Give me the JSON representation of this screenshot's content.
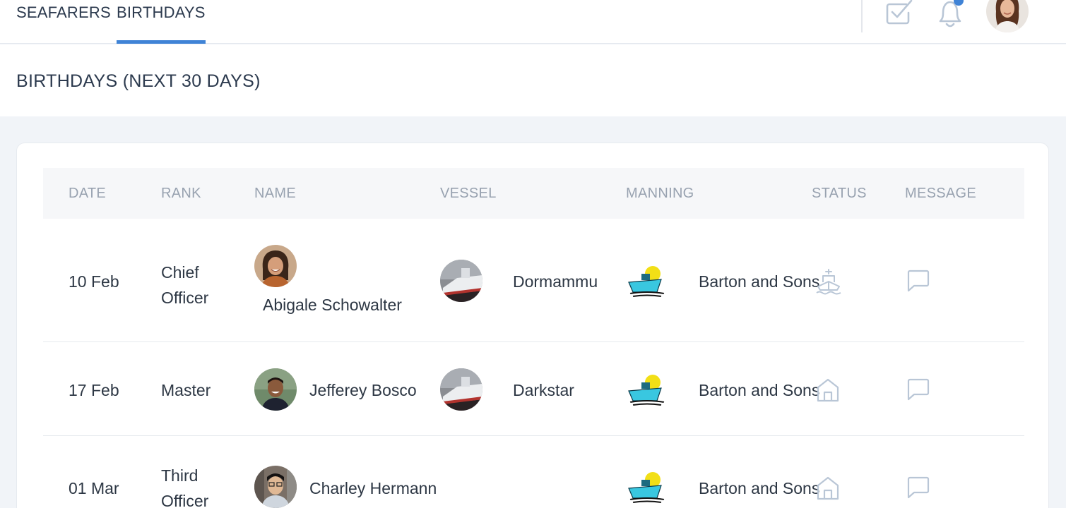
{
  "nav": {
    "tabs": [
      {
        "label": "SEAFARERS",
        "active": false
      },
      {
        "label": "BIRTHDAYS",
        "active": true
      }
    ],
    "icons": [
      "task-check-icon",
      "bell-icon"
    ],
    "notification_dot_color": "#3f83d6"
  },
  "page": {
    "title": "BIRTHDAYS (NEXT 30 DAYS)"
  },
  "table": {
    "columns": [
      "DATE",
      "RANK",
      "NAME",
      "VESSEL",
      "MANNING",
      "STATUS",
      "MESSAGE"
    ],
    "rows": [
      {
        "date": "10 Feb",
        "rank_line1": "Chief",
        "rank_line2": "Officer",
        "name": "Abigale Schowalter",
        "vessel": "Dormammu",
        "manning": "Barton and Sons",
        "status_icon": "ship-icon"
      },
      {
        "date": "17 Feb",
        "rank_line1": "Master",
        "rank_line2": "",
        "name": "Jefferey Bosco",
        "vessel": "Darkstar",
        "manning": "Barton and Sons",
        "status_icon": "home-icon"
      },
      {
        "date": "01 Mar",
        "rank_line1": "Third",
        "rank_line2": "Officer",
        "name": "Charley Hermann",
        "vessel": "",
        "manning": "Barton and Sons",
        "status_icon": "home-icon"
      }
    ]
  },
  "colors": {
    "accent": "#3f83d6",
    "page_background": "#f1f4f8",
    "header_text": "#98a2b0",
    "icon_muted": "#b9c6d6"
  }
}
